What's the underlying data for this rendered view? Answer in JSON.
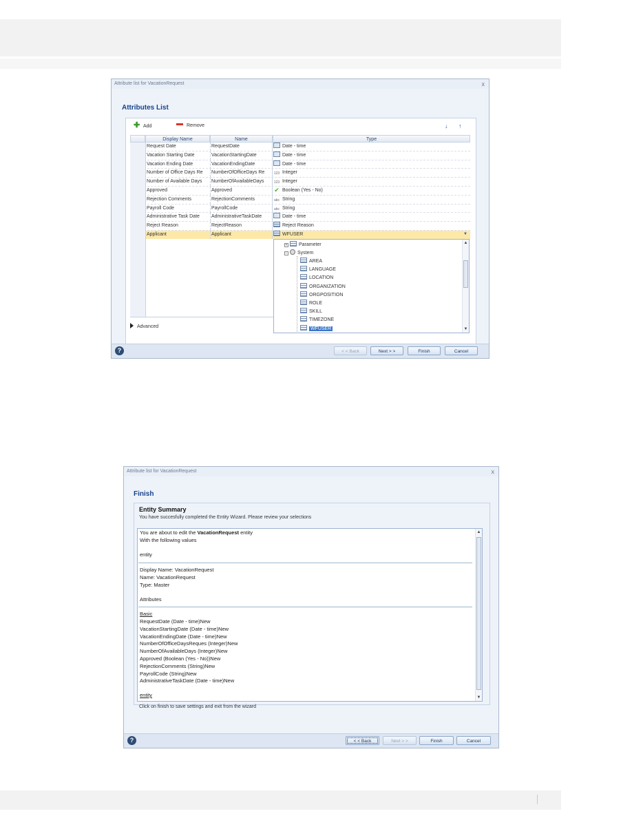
{
  "dialog1": {
    "title": "Attribute list for VacationRequest",
    "heading": "Attributes List",
    "toolbar": {
      "add_label": "Add",
      "remove_label": "Remove"
    },
    "columns": [
      "Display Name",
      "Name",
      "Type"
    ],
    "rows": [
      {
        "display": "Request Date",
        "name": "RequestDate",
        "type": "Date - time",
        "icon": "calendar-icon"
      },
      {
        "display": "Vacation Starting Date",
        "name": "VacationStartingDate",
        "type": "Date - time",
        "icon": "calendar-icon"
      },
      {
        "display": "Vacation Ending Date",
        "name": "VacationEndingDate",
        "type": "Date - time",
        "icon": "calendar-icon"
      },
      {
        "display": "Number of Office Days Re",
        "name": "NumberOfOfficeDays Re",
        "type": "Integer",
        "icon": "integer-icon"
      },
      {
        "display": "Number of Available Days",
        "name": "NumberOfAvailableDays",
        "type": "Integer",
        "icon": "integer-icon"
      },
      {
        "display": "Approved",
        "name": "Approved",
        "type": "Boolean (Yes - No)",
        "icon": "checkmark-icon"
      },
      {
        "display": "Rejection Comments",
        "name": "RejectionComments",
        "type": "String",
        "icon": "string-icon"
      },
      {
        "display": "Payroll Code",
        "name": "PayrollCode",
        "type": "String",
        "icon": "string-icon"
      },
      {
        "display": "Administrative Task Date",
        "name": "AdministrativeTaskDate",
        "type": "Date - time",
        "icon": "calendar-icon"
      },
      {
        "display": "Reject Reason",
        "name": "RejectReason",
        "type": "Reject Reason",
        "icon": "table-icon"
      },
      {
        "display": "Applicant",
        "name": "Applicant",
        "type": "WFUSER",
        "icon": "table-icon"
      }
    ],
    "tree": {
      "parameter": "Parameter",
      "system": "System",
      "items": [
        "AREA",
        "LANGUAGE",
        "LOCATION",
        "ORGANIZATION",
        "ORGPOSITION",
        "ROLE",
        "SKILL",
        "TIMEZONE",
        "WFUSER"
      ]
    },
    "advanced_label": "Advanced",
    "buttons": {
      "back": "< < Back",
      "next": "Next > >",
      "finish": "Finish",
      "cancel": "Cancel"
    }
  },
  "dialog2": {
    "title": "Attribute list for VacationRequest",
    "heading": "Finish",
    "summary_title": "Entity Summary",
    "summary_subtitle": "You have succesfully completed the Entity Wizard. Please review your selections",
    "intro_pre": "You are about to edit the ",
    "intro_entity": "VacationRequest",
    "intro_post": " entity",
    "intro_line2": "With the following values",
    "section_entity": "entity",
    "display_name": "Display Name: VacationRequest",
    "name": "Name: VacationRequest",
    "type": "Type: Master",
    "section_attributes": "Attributes",
    "basic_label": "Basic",
    "attribute_lines": [
      "RequestDate (Date - time)New",
      "VacationStartingDate (Date - time)New",
      "VacationEndingDate (Date - time)New",
      "NumberOfOfficeDaysReques (Integer)New",
      "NumberOfAvailableDays (Integer)New",
      "Approved (Boolean (Yes - No))New",
      "RejectionComments (String)New",
      "PayrollCode (String)New",
      "AdministrativeTaskDate (Date - time)New"
    ],
    "section_entity2": "entity",
    "footer_note": "Click on finish to save settings and exit from the wizard",
    "buttons": {
      "back": "< < Back",
      "next": "Next > >",
      "finish": "Finish",
      "cancel": "Cancel"
    }
  }
}
